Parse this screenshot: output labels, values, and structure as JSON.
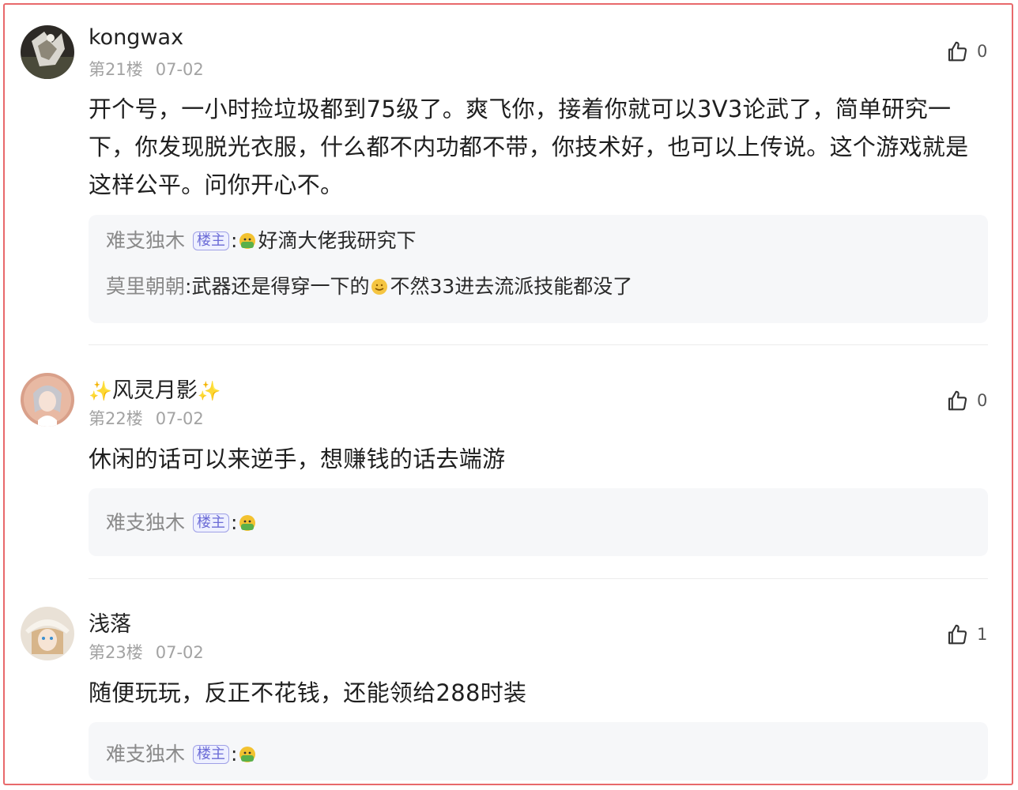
{
  "comments": [
    {
      "username": "kongwax",
      "floor": "第21楼",
      "date": "07-02",
      "likes": "0",
      "text": "开个号，一小时捡垃圾都到75级了。爽飞你，接着你就可以3V3论武了，简单研究一下，你发现脱光衣服，什么都不内功都不带，你技术好，也可以上传说。这个游戏就是这样公平。问你开心不。",
      "replies": [
        {
          "name": "难支独木",
          "tag": "楼主",
          "sep": ":",
          "emoji": "emoji-face-icon",
          "text": "好滴大佬我研究下"
        },
        {
          "name": "莫里朝朝",
          "sep": ":",
          "text_before": "武器还是得穿一下的",
          "emoji": "emoji-smile-icon",
          "text_after": "不然33进去流派技能都没了"
        }
      ]
    },
    {
      "username_prefix": "✨",
      "username": "风灵月影",
      "username_suffix": "✨",
      "floor": "第22楼",
      "date": "07-02",
      "likes": "0",
      "text": "休闲的话可以来逆手，想赚钱的话去端游",
      "replies": [
        {
          "name": "难支独木",
          "tag": "楼主",
          "sep": ":",
          "emoji": "emoji-face-icon"
        }
      ]
    },
    {
      "username": "浅落",
      "floor": "第23楼",
      "date": "07-02",
      "likes": "1",
      "text": "随便玩玩，反正不花钱，还能领给288时装",
      "replies": [
        {
          "name": "难支独木",
          "tag": "楼主",
          "sep": ":",
          "emoji": "emoji-face-icon"
        }
      ]
    }
  ],
  "colors": {
    "frame": "#e8696b",
    "reply_bg": "#f6f7f9",
    "tag": "#6b6bd6",
    "meta": "#a3a3a3"
  }
}
